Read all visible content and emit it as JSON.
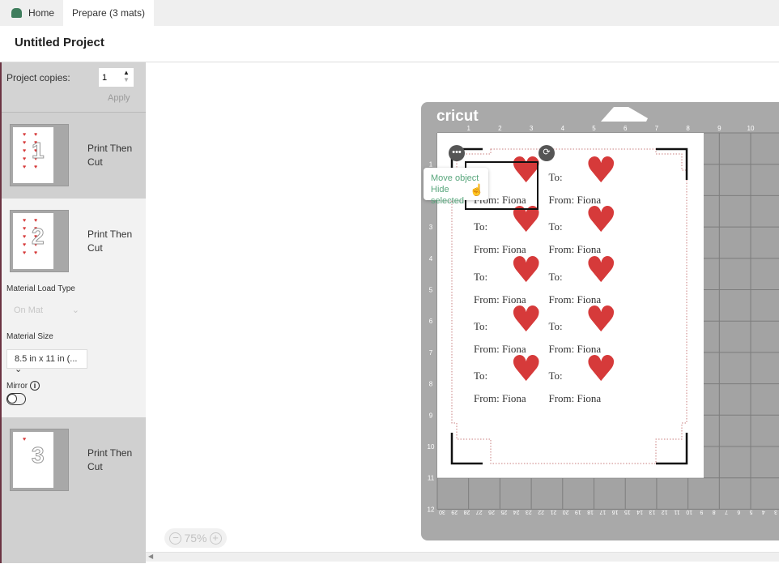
{
  "tabs": {
    "home": "Home",
    "prepare": "Prepare (3 mats)"
  },
  "title": "Untitled Project",
  "project_copies": {
    "label": "Project copies:",
    "value": "1",
    "apply": "Apply"
  },
  "mats": [
    {
      "number": "1",
      "label": "Print Then Cut"
    },
    {
      "number": "2",
      "label": "Print Then Cut"
    },
    {
      "number": "3",
      "label": "Print Then Cut"
    }
  ],
  "material_load_type": {
    "label": "Material Load Type",
    "value": "On Mat"
  },
  "material_size": {
    "label": "Material Size",
    "value": "8.5 in x 11 in (..."
  },
  "mirror": {
    "label": "Mirror",
    "on": false
  },
  "zoom": {
    "value": "75%",
    "minus": "−",
    "plus": "+"
  },
  "mat_canvas": {
    "brand": "cricut",
    "top_ruler": [
      "1",
      "2",
      "3",
      "4",
      "5",
      "6",
      "7",
      "8",
      "9",
      "10"
    ],
    "left_ruler": [
      "1",
      "2",
      "3",
      "4",
      "5",
      "6",
      "7",
      "8",
      "9",
      "10",
      "11",
      "12"
    ],
    "bottom_ruler": [
      "30",
      "29",
      "28",
      "27",
      "26",
      "25",
      "24",
      "23",
      "22",
      "21",
      "20",
      "19",
      "18",
      "17",
      "16",
      "15",
      "14",
      "13",
      "12",
      "11",
      "10",
      "9",
      "8",
      "7",
      "6",
      "5",
      "4",
      "3"
    ],
    "cards": [
      {
        "to": "To:",
        "from": "From: Fiona"
      },
      {
        "to": "To:",
        "from": "From: Fiona"
      },
      {
        "to": "To:",
        "from": "From: Fiona"
      },
      {
        "to": "To:",
        "from": "From: Fiona"
      },
      {
        "to": "To:",
        "from": "From: Fiona"
      },
      {
        "to": "To:",
        "from": "From: Fiona"
      },
      {
        "to": "To:",
        "from": "From: Fiona"
      },
      {
        "to": "To:",
        "from": "From: Fiona"
      },
      {
        "to": "To:",
        "from": "From: Fiona"
      },
      {
        "to": "To:",
        "from": "From: Fiona"
      }
    ],
    "heart_color": "#d63a3a"
  },
  "context_menu": {
    "move": "Move object",
    "hide": "Hide selected"
  },
  "colors": {
    "accent": "#58a67c",
    "mat": "#a9a9a9"
  }
}
